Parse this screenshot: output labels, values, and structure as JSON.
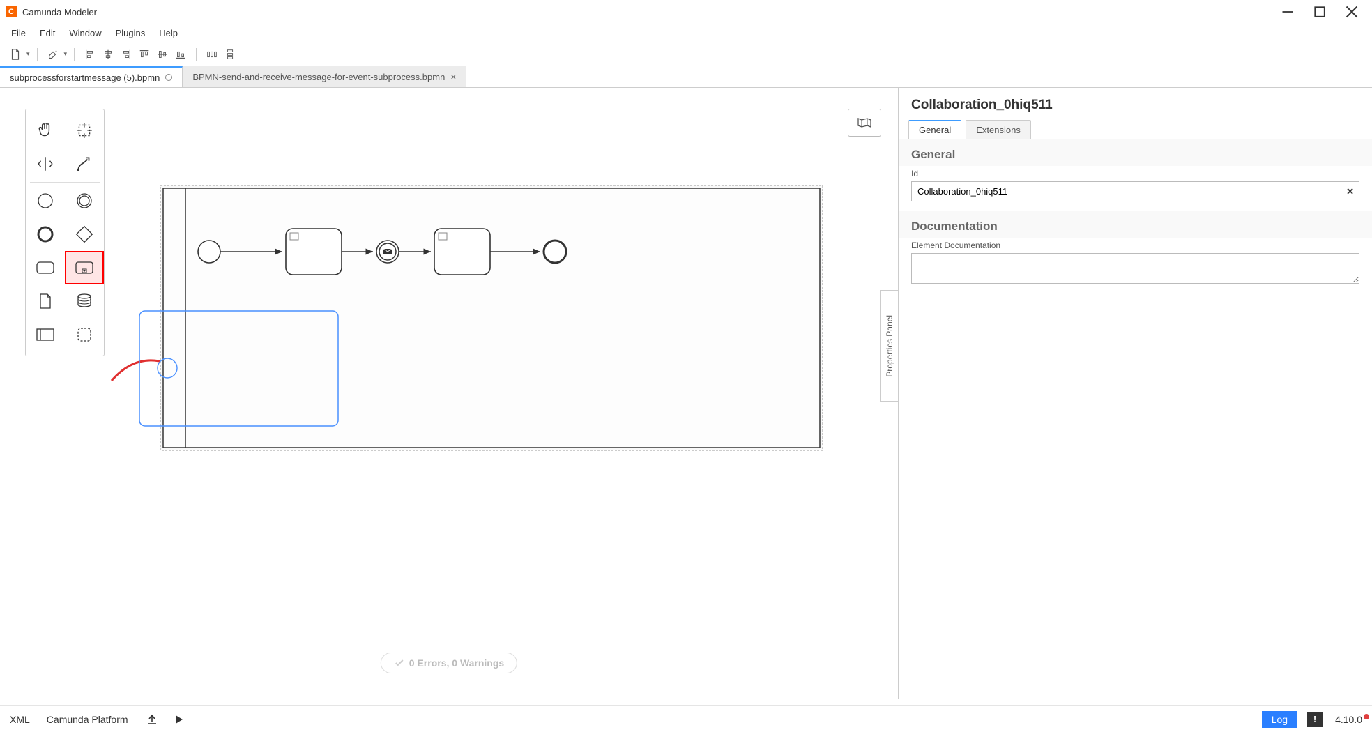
{
  "app": {
    "title": "Camunda Modeler"
  },
  "menu": {
    "file": "File",
    "edit": "Edit",
    "window": "Window",
    "plugins": "Plugins",
    "help": "Help"
  },
  "tabs": [
    {
      "label": "subprocessforstartmessage (5).bpmn",
      "dirty": true,
      "active": true
    },
    {
      "label": "BPMN-send-and-receive-message-for-event-subprocess.bpmn",
      "dirty": false,
      "active": false
    }
  ],
  "properties_tab_label": "Properties Panel",
  "status": {
    "text": "0 Errors, 0 Warnings"
  },
  "panel": {
    "title": "Collaboration_0hiq511",
    "tabs": {
      "general": "General",
      "extensions": "Extensions"
    },
    "section_general": "General",
    "id_label": "Id",
    "id_value": "Collaboration_0hiq511",
    "section_doc": "Documentation",
    "doc_label": "Element Documentation",
    "doc_value": ""
  },
  "footer": {
    "xml": "XML",
    "platform": "Camunda Platform",
    "log": "Log",
    "version": "4.10.0"
  }
}
